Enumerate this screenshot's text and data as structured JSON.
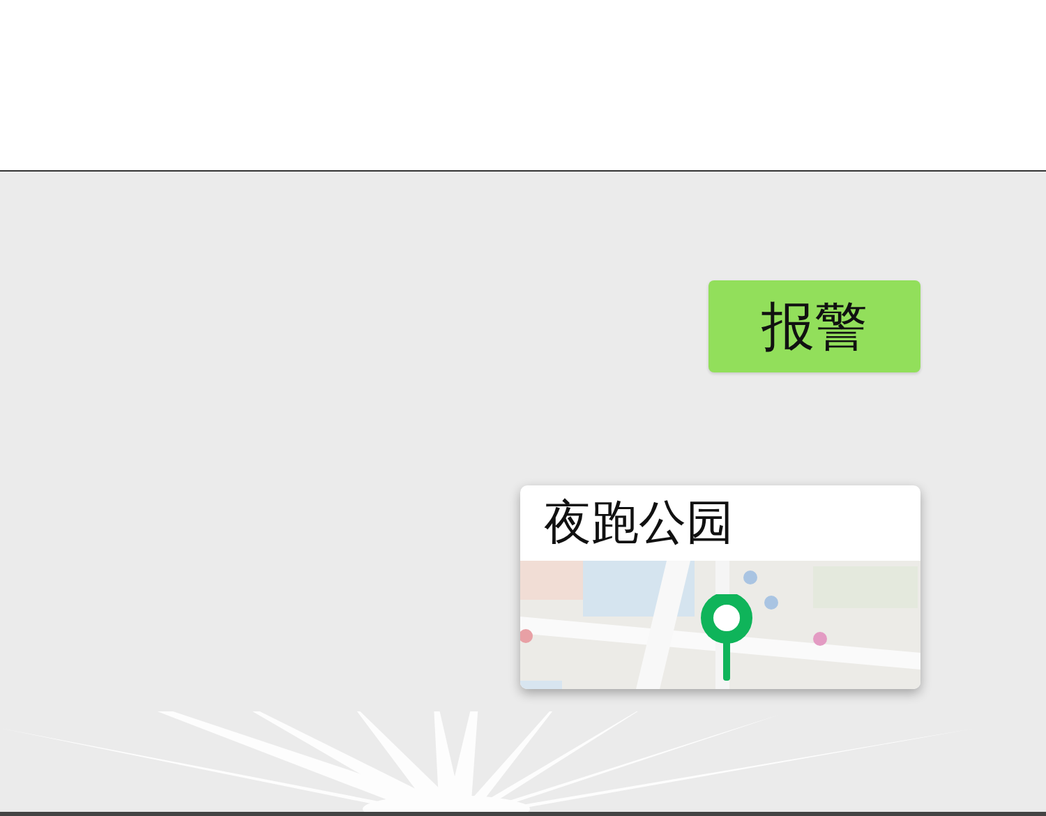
{
  "messages": [
    {
      "kind": "text",
      "text": "报警"
    },
    {
      "kind": "location",
      "title": "夜跑公园"
    }
  ]
}
